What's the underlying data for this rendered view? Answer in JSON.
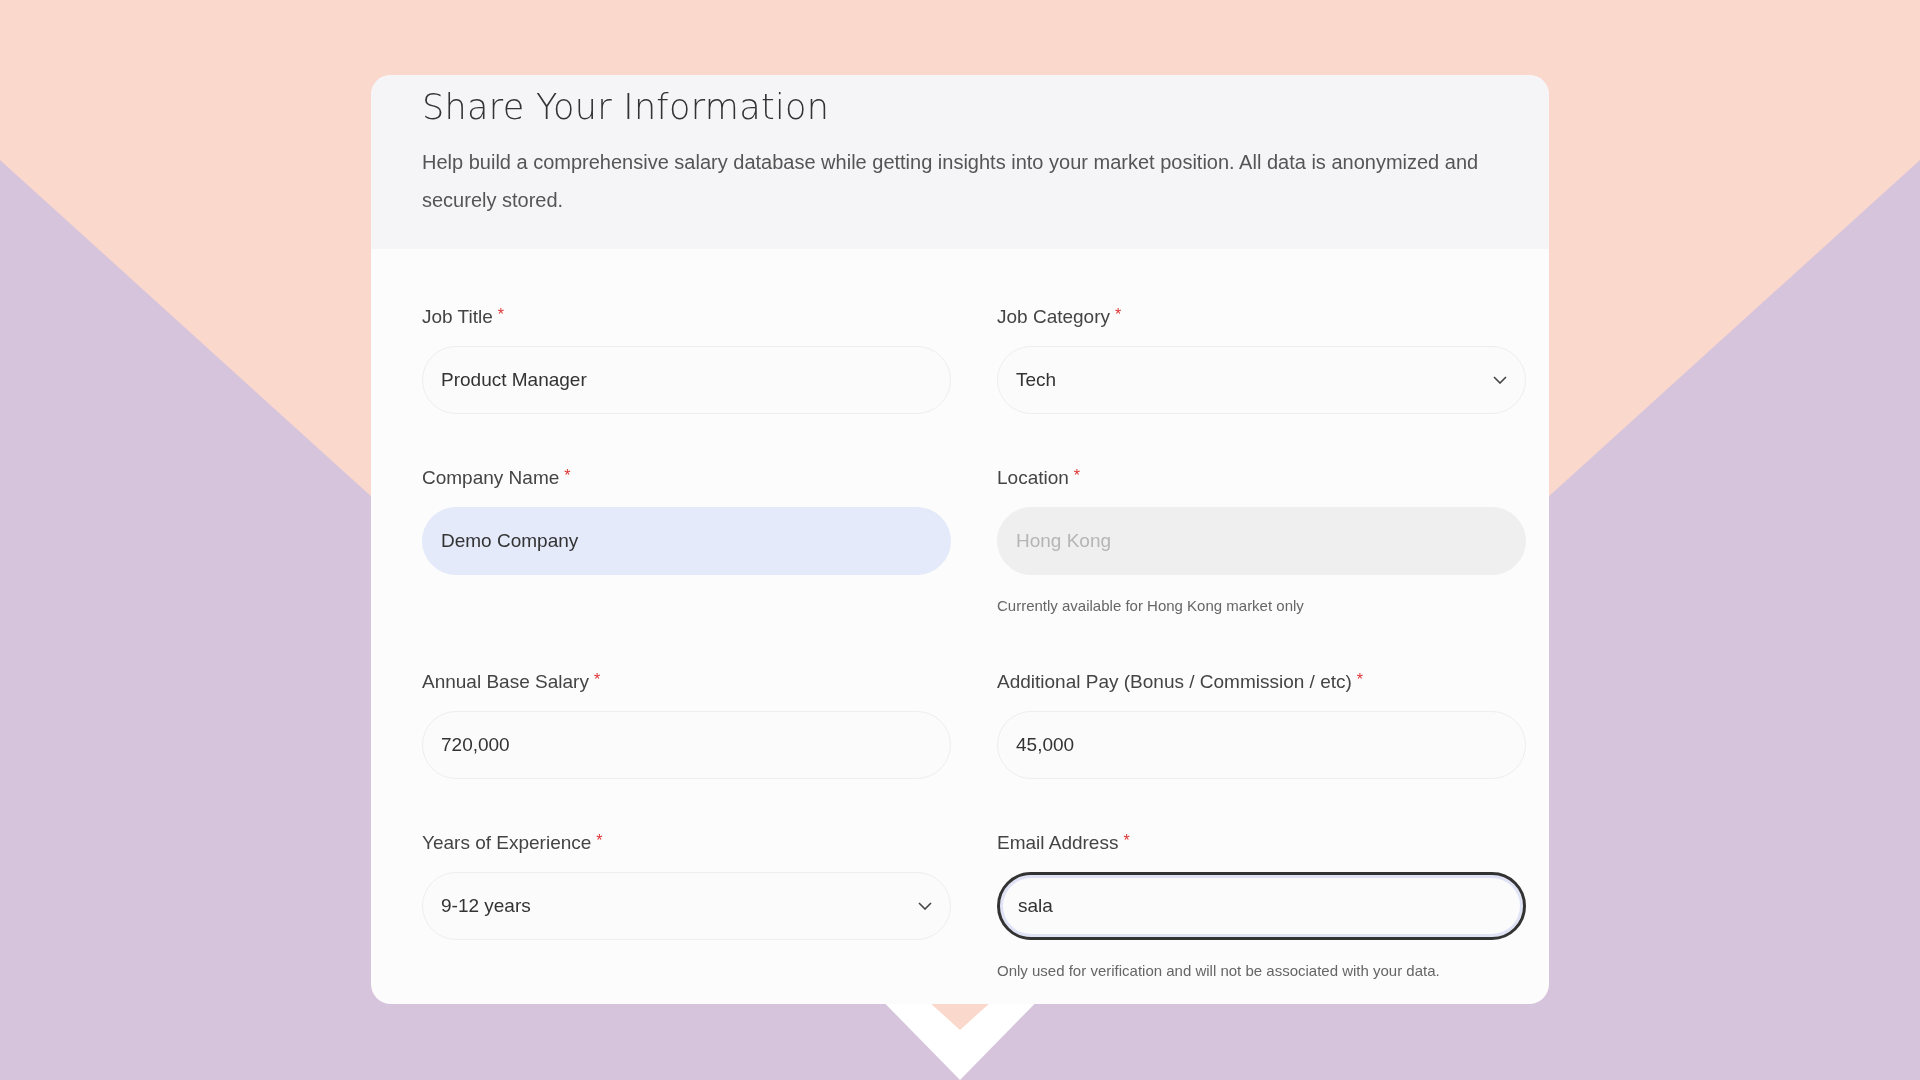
{
  "header": {
    "title": "Share Your Information",
    "description": "Help build a comprehensive salary database while getting insights into your market position. All data is anonymized and securely stored."
  },
  "fields": [
    {
      "kind": "text",
      "label": "Job Title",
      "required_mark": "*",
      "value": "Product Manager",
      "autofilled": false,
      "disabled": false,
      "focused": false
    },
    {
      "kind": "select",
      "label": "Job Category",
      "required_mark": "*",
      "value": "Tech",
      "autofilled": false,
      "disabled": false,
      "focused": false
    },
    {
      "kind": "text",
      "label": "Company Name",
      "required_mark": "*",
      "value": "Demo Company",
      "autofilled": true,
      "disabled": false,
      "focused": false
    },
    {
      "kind": "text",
      "label": "Location",
      "required_mark": "*",
      "placeholder": "Hong Kong",
      "autofilled": false,
      "disabled": true,
      "focused": false,
      "hint": "Currently available for Hong Kong market only"
    },
    {
      "kind": "text",
      "label": "Annual Base Salary",
      "required_mark": "*",
      "value": "720,000",
      "autofilled": false,
      "disabled": false,
      "focused": false
    },
    {
      "kind": "text",
      "label": "Additional Pay (Bonus / Commission / etc)",
      "required_mark": "*",
      "value": "45,000",
      "autofilled": false,
      "disabled": false,
      "focused": false
    },
    {
      "kind": "select",
      "label": "Years of Experience",
      "required_mark": "*",
      "value": "9-12 years",
      "autofilled": false,
      "disabled": false,
      "focused": false
    },
    {
      "kind": "text",
      "label": "Email Address",
      "required_mark": "*",
      "value": "sala",
      "autofilled": false,
      "disabled": false,
      "focused": true,
      "hint": "Only used for verification and will not be associated with your data."
    }
  ]
}
